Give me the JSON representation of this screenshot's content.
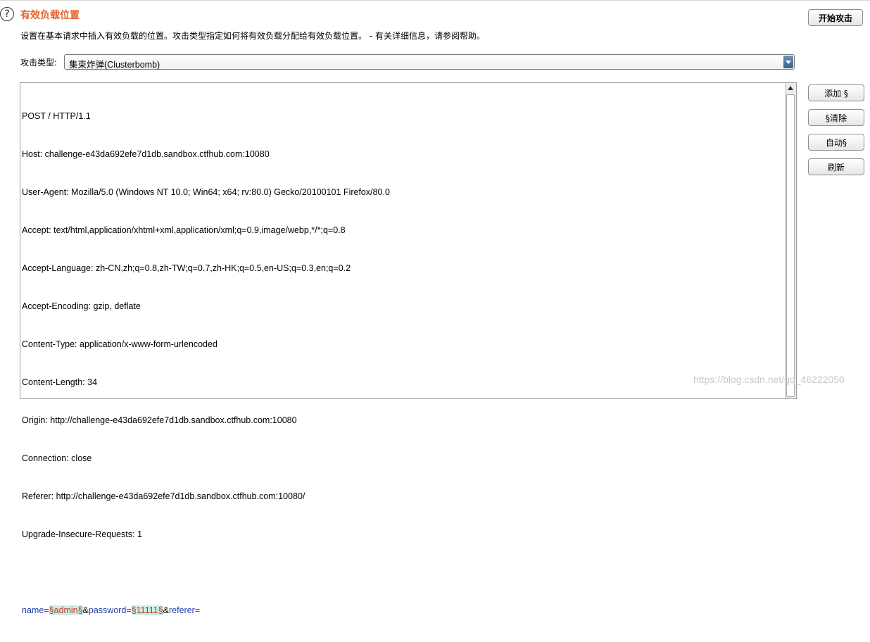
{
  "header": {
    "help_icon": "question-circle-icon",
    "title": "有效负载位置",
    "description": "设置在基本请求中插入有效负载的位置。攻击类型指定如何将有效负载分配给有效负载位置。 - 有关详细信息，请参阅帮助。",
    "start_attack_label": "开始攻击"
  },
  "attack_type": {
    "label": "攻击类型:",
    "selected": "集束炸弹(Clusterbomb)"
  },
  "request": {
    "lines": [
      "POST / HTTP/1.1",
      "Host: challenge-e43da692efe7d1db.sandbox.ctfhub.com:10080",
      "User-Agent: Mozilla/5.0 (Windows NT 10.0; Win64; x64; rv:80.0) Gecko/20100101 Firefox/80.0",
      "Accept: text/html,application/xhtml+xml,application/xml;q=0.9,image/webp,*/*;q=0.8",
      "Accept-Language: zh-CN,zh;q=0.8,zh-TW;q=0.7,zh-HK;q=0.5,en-US;q=0.3,en;q=0.2",
      "Accept-Encoding: gzip, deflate",
      "Content-Type: application/x-www-form-urlencoded",
      "Content-Length: 34",
      "Origin: http://challenge-e43da692efe7d1db.sandbox.ctfhub.com:10080",
      "Connection: close",
      "Referer: http://challenge-e43da692efe7d1db.sandbox.ctfhub.com:10080/",
      "Upgrade-Insecure-Requests: 1",
      ""
    ],
    "body": {
      "param1": "name",
      "eq1": "=",
      "payload1": "§admin§",
      "sep1": "&",
      "param2": "password",
      "eq2": "=",
      "payload2": "§11111§",
      "sep2": "&",
      "param3": "referer",
      "eq3": "="
    }
  },
  "side_buttons": {
    "add": "添加 §",
    "clear": "§清除",
    "auto": "自动§",
    "refresh": "刷新"
  },
  "watermark": "https://blog.csdn.net/qq_46222050"
}
